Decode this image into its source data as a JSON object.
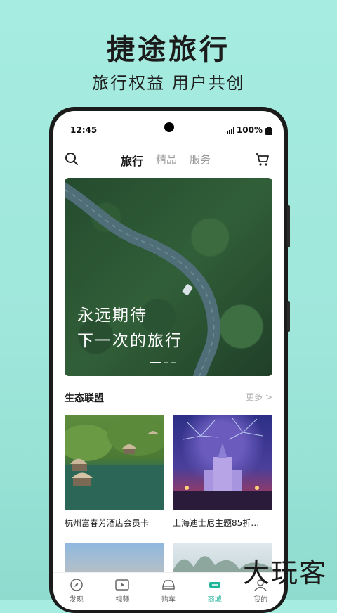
{
  "promo": {
    "headline": "捷途旅行",
    "subline": "旅行权益 用户共创"
  },
  "status_bar": {
    "time": "12:45",
    "battery": "100%"
  },
  "top_nav": {
    "tabs": [
      {
        "label": "旅行",
        "active": true
      },
      {
        "label": "精品",
        "active": false
      },
      {
        "label": "服务",
        "active": false
      }
    ],
    "search_icon": "search-icon",
    "cart_icon": "cart-icon"
  },
  "banner": {
    "line1": "永远期待",
    "line2": "下一次的旅行",
    "page_indicator": {
      "count": 3,
      "active": 0
    }
  },
  "section": {
    "title": "生态联盟",
    "more": "更多 >"
  },
  "cards": [
    {
      "caption": "杭州富春芳酒店会员卡"
    },
    {
      "caption": "上海迪士尼主题85折…"
    },
    {
      "caption": ""
    },
    {
      "caption": ""
    }
  ],
  "bottom_nav": {
    "items": [
      {
        "label": "发现",
        "icon": "compass-icon",
        "active": false
      },
      {
        "label": "视频",
        "icon": "video-icon",
        "active": false
      },
      {
        "label": "购车",
        "icon": "car-icon",
        "active": false
      },
      {
        "label": "商城",
        "icon": "shop-icon",
        "active": true
      },
      {
        "label": "我的",
        "icon": "user-icon",
        "active": false
      }
    ]
  },
  "watermark": "大玩客",
  "colors": {
    "background": "#a6ece0",
    "accent": "#1fb59b",
    "text_dark": "#1b1b1b"
  }
}
